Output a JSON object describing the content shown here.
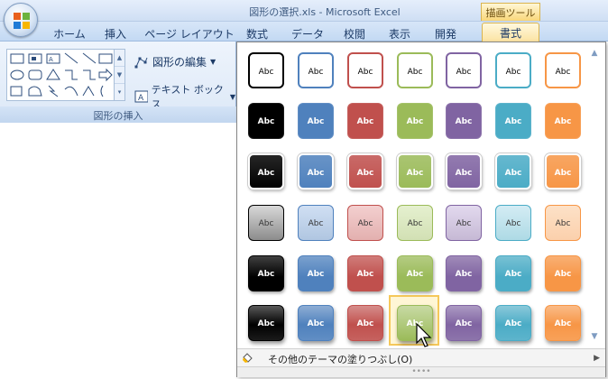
{
  "window": {
    "title": "図形の選択.xls - Microsoft Excel",
    "contextual_group": "描画ツール"
  },
  "tabs": [
    {
      "label": "ホーム",
      "active": false
    },
    {
      "label": "挿入",
      "active": false
    },
    {
      "label": "ページ レイアウト",
      "active": false
    },
    {
      "label": "数式",
      "active": false
    },
    {
      "label": "データ",
      "active": false
    },
    {
      "label": "校閲",
      "active": false
    },
    {
      "label": "表示",
      "active": false
    },
    {
      "label": "開発",
      "active": false
    },
    {
      "label": "書式",
      "active": true
    }
  ],
  "ribbon": {
    "edit_shape_label": "図形の編集",
    "text_box_label": "テキスト ボックス",
    "group_label": "図形の挿入"
  },
  "gallery": {
    "tile_label": "Abc",
    "more_label": "その他のテーマの塗りつぶし(O)",
    "colors": [
      "#000000",
      "#4f81bd",
      "#c0504d",
      "#9bbb59",
      "#8064a2",
      "#4bacc6",
      "#f79646"
    ],
    "light_colors": [
      "#d8d8d8",
      "#d0dff3",
      "#f3cfcf",
      "#e5f0cf",
      "#e2d9ee",
      "#d4ecf4",
      "#fde1c7"
    ],
    "highlighted": {
      "row": 6,
      "col": 4
    }
  }
}
